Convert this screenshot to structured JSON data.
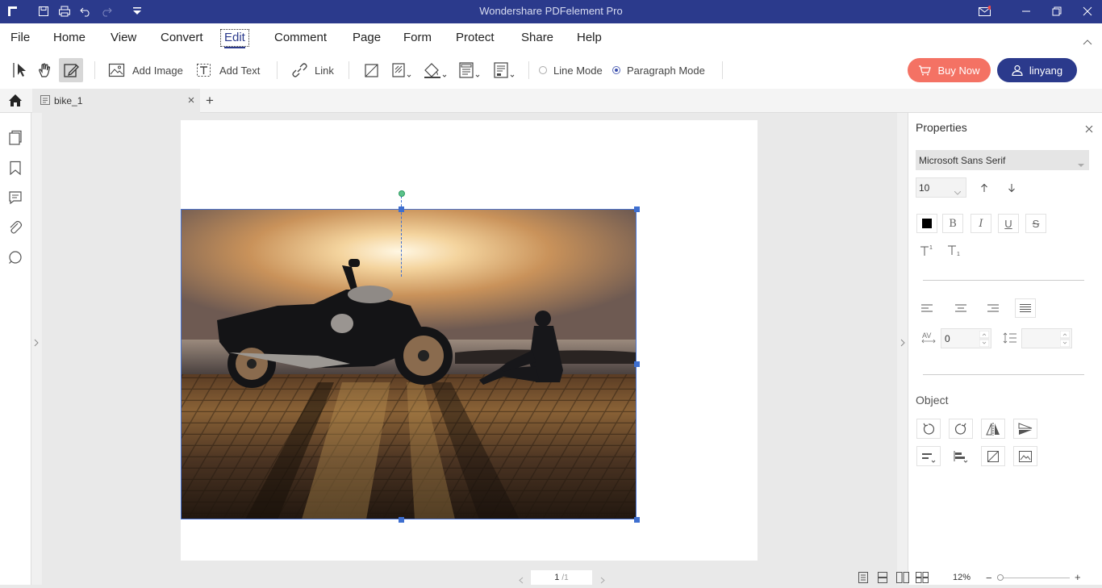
{
  "window": {
    "title": "Wondershare PDFelement Pro"
  },
  "menu": {
    "file": "File",
    "home": "Home",
    "view": "View",
    "convert": "Convert",
    "edit": "Edit",
    "comment": "Comment",
    "page": "Page",
    "form": "Form",
    "protect": "Protect",
    "share": "Share",
    "help": "Help"
  },
  "toolbar": {
    "add_image": "Add Image",
    "add_text": "Add Text",
    "link": "Link",
    "line_mode": "Line Mode",
    "paragraph_mode": "Paragraph Mode",
    "selected_mode": "Paragraph Mode"
  },
  "account": {
    "buy_now": "Buy Now",
    "user": "linyang"
  },
  "tabs": {
    "doc": "bike_1",
    "add": "+"
  },
  "properties": {
    "title": "Properties",
    "font": "Microsoft Sans Serif",
    "size": "10",
    "char_spacing": "0",
    "line_spacing": "",
    "text_color": "#000000",
    "object_title": "Object"
  },
  "status": {
    "page_current": "1",
    "page_total": "/1",
    "zoom": "12%"
  },
  "colors": {
    "title_bar": "#2b3a8c",
    "accent": "#2b3a8c",
    "buy": "#f47264",
    "handle": "#3e6fd0",
    "rotate_handle": "#3cb97a"
  }
}
